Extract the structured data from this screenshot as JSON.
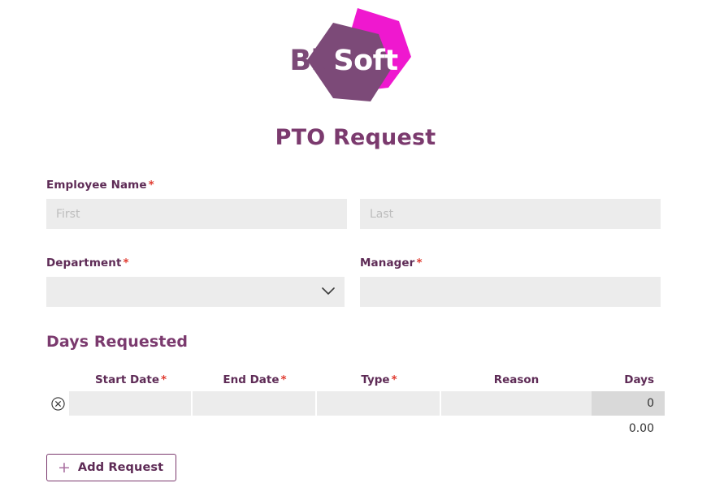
{
  "brand": {
    "name_part1": "Bit",
    "name_part2": "Soft",
    "color_magenta": "#ef18cf",
    "color_purple": "#7c4a78"
  },
  "header": {
    "title": "PTO Request",
    "title_color": "#7b3a6e"
  },
  "form": {
    "employee_name": {
      "label": "Employee Name",
      "required_mark": "*",
      "first": {
        "value": "",
        "placeholder": "First"
      },
      "last": {
        "value": "",
        "placeholder": "Last"
      }
    },
    "department": {
      "label": "Department",
      "required_mark": "*",
      "value": "",
      "options": [
        ""
      ]
    },
    "manager": {
      "label": "Manager",
      "required_mark": "*",
      "value": "",
      "placeholder": ""
    }
  },
  "days_requested": {
    "heading": "Days Requested",
    "columns": [
      {
        "label": "Start Date",
        "required_mark": "*"
      },
      {
        "label": "End Date",
        "required_mark": "*"
      },
      {
        "label": "Type",
        "required_mark": "*"
      },
      {
        "label": "Reason",
        "required_mark": ""
      },
      {
        "label": "Days",
        "required_mark": ""
      }
    ],
    "rows": [
      {
        "start_date": "",
        "end_date": "",
        "type": "",
        "reason": "",
        "days": "0",
        "delete_icon": "circle-x-icon"
      }
    ],
    "total": "0.00",
    "add_button": {
      "label": "Add Request",
      "icon": "plus-icon"
    }
  }
}
